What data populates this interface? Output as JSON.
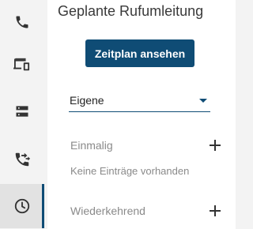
{
  "rail": {
    "items": [
      {
        "icon": "phone-icon",
        "active": false
      },
      {
        "icon": "devices-icon",
        "active": false
      },
      {
        "icon": "storage-icon",
        "active": false
      },
      {
        "icon": "call-forward-icon",
        "active": false
      },
      {
        "icon": "clock-icon",
        "active": true
      }
    ]
  },
  "panel": {
    "title": "Geplante Rufumleitung",
    "view_schedule_label": "Zeitplan ansehen",
    "dropdown": {
      "selected": "Eigene"
    },
    "one_time": {
      "label": "Einmalig",
      "empty_text": "Keine Einträge vorhanden"
    },
    "recurring": {
      "label": "Wiederkehrend"
    }
  },
  "colors": {
    "primary": "#0f4c75",
    "rail_bg": "#f3f3f3",
    "active_item_bg": "#e2e2e2",
    "muted_text": "#8a8a8a"
  }
}
